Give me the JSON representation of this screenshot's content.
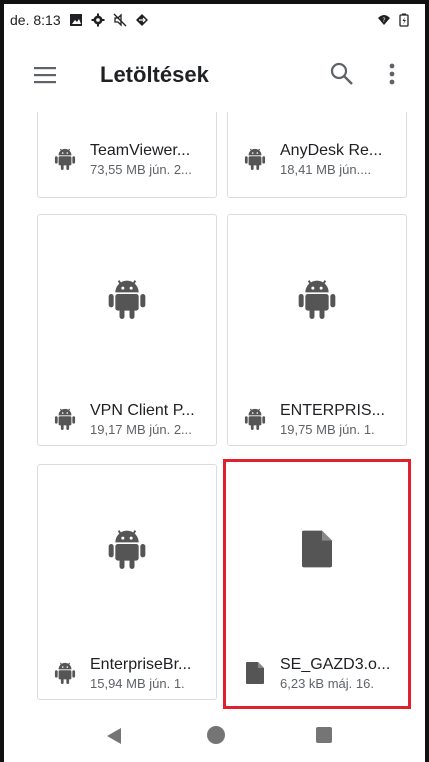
{
  "status_bar": {
    "time": "de. 8:13",
    "icons": [
      "image-icon",
      "settings-icon",
      "mute-icon",
      "data-icon",
      "wifi-icon",
      "battery-icon"
    ]
  },
  "app_bar": {
    "title": "Letöltések",
    "menu_icon": "menu-icon",
    "search_icon": "search-icon",
    "more_icon": "more-vert-icon"
  },
  "files": [
    {
      "name": "TeamViewer...",
      "meta": "73,55 MB jún. 2...",
      "icon": "android-icon"
    },
    {
      "name": "AnyDesk Re...",
      "meta": "18,41 MB jún....",
      "icon": "android-icon"
    },
    {
      "name": "VPN Client P...",
      "meta": "19,17 MB jún. 2...",
      "icon": "android-icon"
    },
    {
      "name": "ENTERPRIS...",
      "meta": "19,75 MB jún. 1.",
      "icon": "android-icon"
    },
    {
      "name": "EnterpriseBr...",
      "meta": "15,94 MB jún. 1.",
      "icon": "android-icon"
    },
    {
      "name": "SE_GAZD3.o...",
      "meta": "6,23 kB máj. 16.",
      "icon": "document-icon"
    }
  ],
  "nav_bar": {
    "back": "back-icon",
    "home": "home-icon",
    "recents": "recents-icon"
  },
  "colors": {
    "highlight": "#e0202b",
    "icon_gray": "#555555",
    "card_border": "#dadce0"
  }
}
